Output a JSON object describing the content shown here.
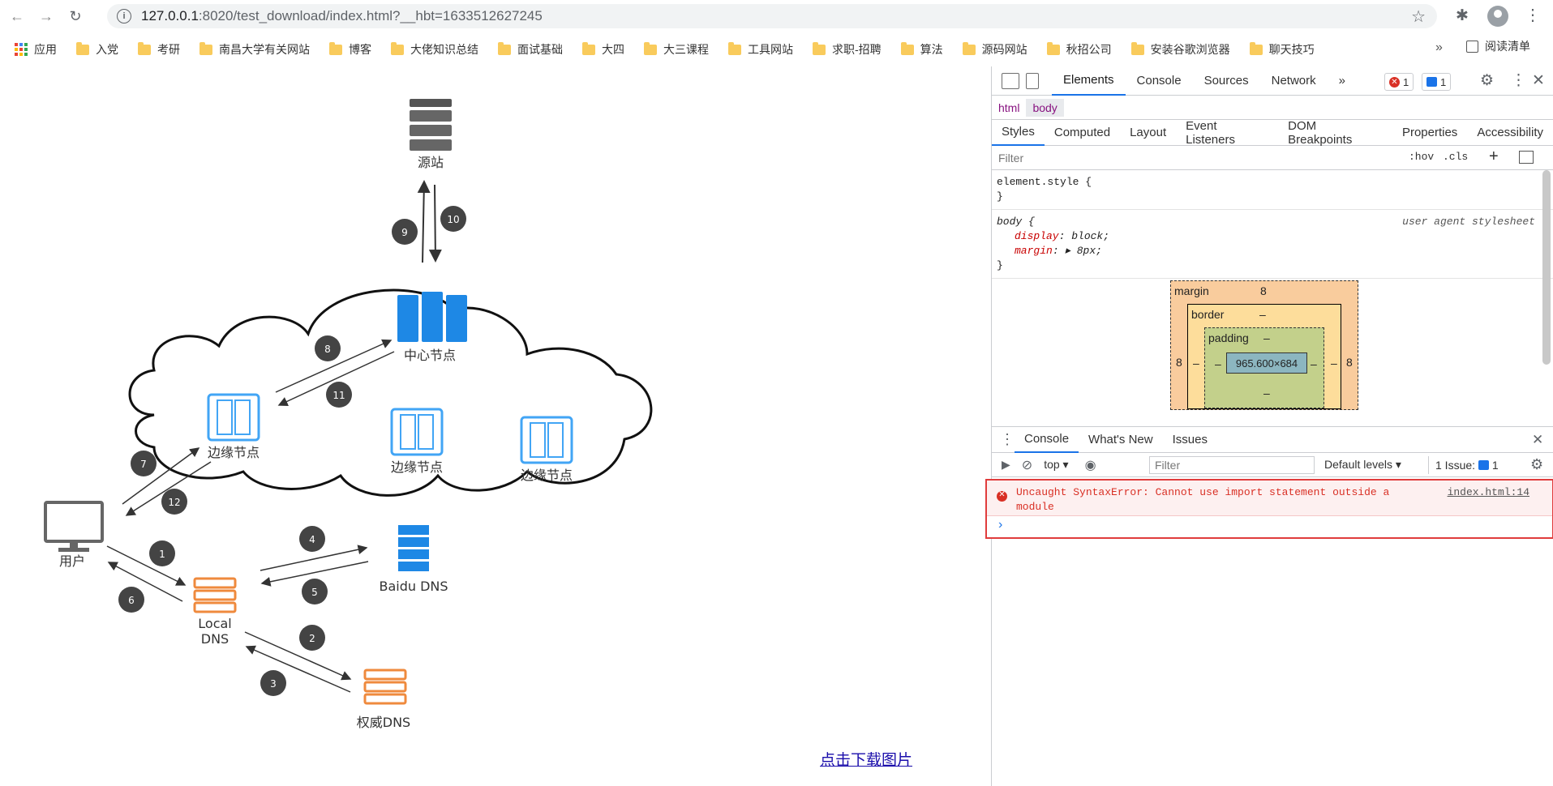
{
  "browser": {
    "url_host": "127.0.0.1",
    "url_rest": ":8020/test_download/index.html?__hbt=1633512627245",
    "bookmarks": [
      "应用",
      "入党",
      "考研",
      "南昌大学有关网站",
      "博客",
      "大佬知识总结",
      "面试基础",
      "大四",
      "大三课程",
      "工具网站",
      "求职-招聘",
      "算法",
      "源码网站",
      "秋招公司",
      "安装谷歌浏览器",
      "聊天技巧"
    ],
    "more_bookmarks": "»",
    "reading_list": "阅读清单"
  },
  "diagram": {
    "nodes": {
      "origin": "源站",
      "center": "中心节点",
      "edge1": "边缘节点",
      "edge2": "边缘节点",
      "edge3": "边缘节点",
      "user": "用户",
      "local_dns_1": "Local",
      "local_dns_2": "DNS",
      "baidu_dns": "Baidu DNS",
      "auth_dns": "权威DNS"
    },
    "steps": [
      "1",
      "2",
      "3",
      "4",
      "5",
      "6",
      "7",
      "8",
      "9",
      "10",
      "11",
      "12"
    ]
  },
  "page": {
    "download_link": "点击下载图片"
  },
  "devtools": {
    "tabs": [
      "Elements",
      "Console",
      "Sources",
      "Network"
    ],
    "more_tabs": "»",
    "error_count": "1",
    "message_count": "1",
    "breadcrumbs": [
      "html",
      "body"
    ],
    "subtabs": [
      "Styles",
      "Computed",
      "Layout",
      "Event Listeners",
      "DOM Breakpoints",
      "Properties",
      "Accessibility"
    ],
    "filter_placeholder": "Filter",
    "hov": ":hov",
    "cls": ".cls",
    "rules": {
      "element_style_open": "element.style {",
      "close": "}",
      "body_open": "body {",
      "ua_label": "user agent stylesheet",
      "display_name": "display",
      "display_value": "block;",
      "margin_name": "margin",
      "margin_value": "8px;"
    },
    "box_model": {
      "margin_label": "margin",
      "margin_value": "8",
      "border_label": "border",
      "border_value": "–",
      "padding_label": "padding",
      "padding_value": "–",
      "content": "965.600×684",
      "side_margin": "8",
      "dash": "–"
    },
    "drawer_tabs": [
      "Console",
      "What's New",
      "Issues"
    ],
    "console_toolbar": {
      "context": "top",
      "filter_placeholder": "Filter",
      "levels": "Default levels",
      "issues": "1 Issue:",
      "issue_count": "1"
    },
    "error": {
      "message_line1": "Uncaught SyntaxError: Cannot use import statement outside a",
      "message_line2": "module",
      "source": "index.html:14"
    }
  }
}
